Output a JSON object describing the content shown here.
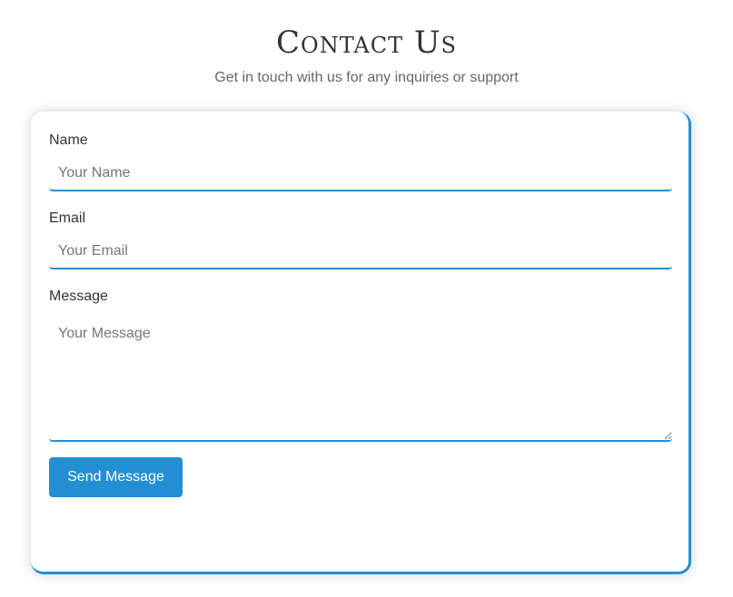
{
  "header": {
    "title": "Contact Us",
    "subtitle": "Get in touch with us for any inquiries or support"
  },
  "form": {
    "name": {
      "label": "Name",
      "placeholder": "Your Name",
      "value": ""
    },
    "email": {
      "label": "Email",
      "placeholder": "Your Email",
      "value": ""
    },
    "message": {
      "label": "Message",
      "placeholder": "Your Message",
      "value": ""
    },
    "submit_label": "Send Message"
  },
  "colors": {
    "accent": "#228fd2",
    "text": "#333333",
    "muted": "#666666",
    "placeholder": "#777777",
    "background": "#ffffff"
  }
}
